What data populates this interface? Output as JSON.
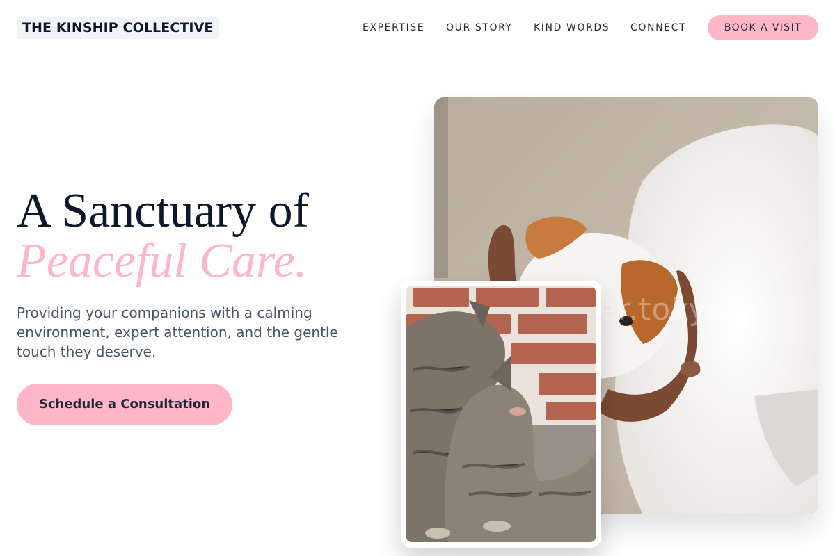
{
  "brand": {
    "name": "THE KINSHIP COLLECTIVE"
  },
  "nav": {
    "links": [
      "EXPERTISE",
      "OUR STORY",
      "KIND WORDS",
      "CONNECT"
    ],
    "cta_label": "BOOK A VISIT"
  },
  "hero": {
    "title_line1": "A Sanctuary of",
    "title_line2": "Peaceful Care.",
    "subtitle": "Providing your companions with a calming environment, expert attention, and the gentle touch they deserve.",
    "cta_label": "Schedule a Consultation"
  },
  "images": {
    "main_watermark": "er.tokyo"
  },
  "colors": {
    "accent": "#ffb6c8",
    "heading": "#0f172a",
    "body_text": "#475569"
  }
}
